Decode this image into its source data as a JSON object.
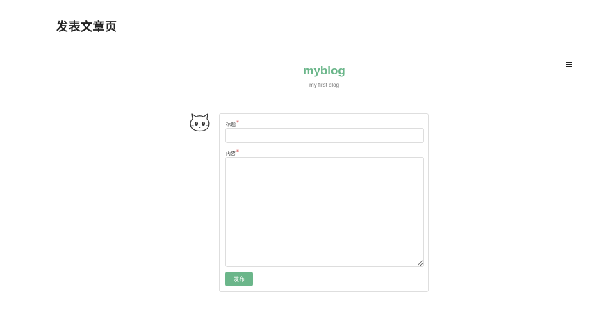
{
  "page": {
    "title": "发表文章页"
  },
  "site": {
    "name": "myblog",
    "description": "my first blog",
    "accent_color": "#6bb68a"
  },
  "header": {
    "menu_icon": "hamburger-menu-icon"
  },
  "user": {
    "avatar_icon": "cat-face-avatar-icon"
  },
  "form": {
    "title_label": "标题",
    "content_label": "内容",
    "required_mark": "*",
    "title_value": "",
    "content_value": "",
    "submit_label": "发布",
    "required_color": "#d33a3a"
  }
}
